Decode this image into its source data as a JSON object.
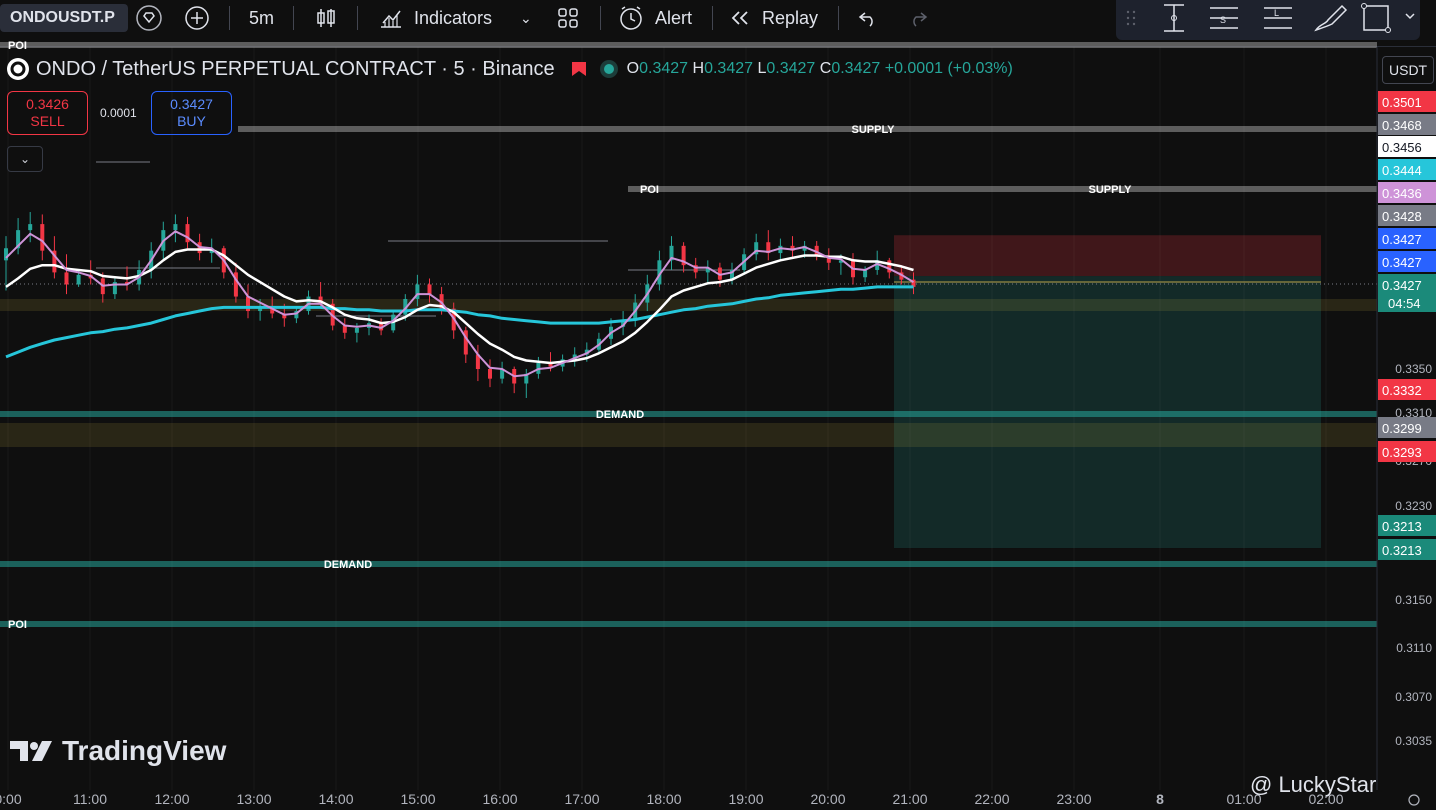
{
  "toolbar": {
    "symbol": "ONDOUSDT.P",
    "interval": "5m",
    "indicators_label": "Indicators",
    "alert_label": "Alert",
    "replay_label": "Replay",
    "icons": [
      "diamond-icon",
      "plus-circle-icon",
      "candles-icon",
      "indicators-icon",
      "chevron-down-icon",
      "layout-grid-icon",
      "alarm-clock-icon",
      "replay-rewind-icon",
      "undo-icon",
      "redo-icon"
    ]
  },
  "legend": {
    "title": "ONDO / TetherUS PERPETUAL CONTRACT · 5 · Binance",
    "o_label": "O",
    "o": "0.3427",
    "h_label": "H",
    "h": "0.3427",
    "l_label": "L",
    "l": "0.3427",
    "c_label": "C",
    "c": "0.3427",
    "change": "+0.0001 (+0.03%)"
  },
  "trade": {
    "sell_price": "0.3426",
    "sell_label": "SELL",
    "spread": "0.0001",
    "buy_price": "0.3427",
    "buy_label": "BUY"
  },
  "currency": "USDT",
  "watermark": "TradingView",
  "author": "@ LuckyStar",
  "colors": {
    "up": "#26a69a",
    "down": "#f23645",
    "ema_fast": "#ce93d8",
    "ema_mid": "#ffffff",
    "ema_slow": "#26c6da"
  },
  "chart_data": {
    "type": "candlestick",
    "ylim": [
      0.3015,
      0.352
    ],
    "x_ticks": [
      "0:00",
      "11:00",
      "12:00",
      "13:00",
      "14:00",
      "15:00",
      "16:00",
      "17:00",
      "18:00",
      "19:00",
      "20:00",
      "21:00",
      "22:00",
      "23:00",
      "8",
      "01:00",
      "02:00"
    ],
    "y_ticks": [
      "0.3350",
      "0.3310",
      "0.3270",
      "0.3230",
      "0.3150",
      "0.3110",
      "0.3070",
      "0.3035"
    ],
    "price_tags": [
      {
        "value": "0.3501",
        "price": 0.3501,
        "color": "#f23645"
      },
      {
        "value": "0.3468",
        "price": 0.3468,
        "color": "#787b86"
      },
      {
        "value": "0.3456",
        "price": 0.3456,
        "color": "#ffffff"
      },
      {
        "value": "0.3444",
        "price": 0.3444,
        "color": "#26c6da"
      },
      {
        "value": "0.3436",
        "price": 0.3436,
        "color": "#ce93d8"
      },
      {
        "value": "0.3428",
        "price": 0.3428,
        "color": "#787b86"
      },
      {
        "value": "0.3427",
        "price": 0.3427,
        "color": "#2962ff"
      },
      {
        "value": "0.3427",
        "price": 0.3417,
        "color": "#2962ff"
      },
      {
        "value": "0.3427",
        "price": 0.3406,
        "color": "#1b8a7a"
      },
      {
        "value": "0.3332",
        "price": 0.3332,
        "color": "#f23645"
      },
      {
        "value": "0.3299",
        "price": 0.3299,
        "color": "#787b86"
      },
      {
        "value": "0.3293",
        "price": 0.3293,
        "color": "#f23645"
      },
      {
        "value": "0.3213",
        "price": 0.3213,
        "color": "#1b8a7a"
      },
      {
        "value": "0.3213",
        "price": 0.32,
        "color": "#1b8a7a"
      }
    ],
    "countdown": "04:54",
    "zones": [
      {
        "label": "SUPPLY",
        "price": 0.3488
      },
      {
        "label": "SUPPLY",
        "price": 0.3439
      },
      {
        "label": "POI",
        "price": 0.3439
      },
      {
        "label": "DEMAND",
        "price": 0.3308
      },
      {
        "label": "DEMAND",
        "price": 0.3165
      },
      {
        "label": "POI",
        "price": 0.3118
      },
      {
        "label": "POI",
        "price": 0.352
      }
    ],
    "position": {
      "entry": 0.3427,
      "stop": 0.345,
      "target": 0.3215
    },
    "ohlc": [
      [
        0.344,
        0.346,
        0.3415,
        0.345
      ],
      [
        0.345,
        0.3475,
        0.3445,
        0.3465
      ],
      [
        0.3465,
        0.348,
        0.3455,
        0.347
      ],
      [
        0.347,
        0.3478,
        0.344,
        0.3448
      ],
      [
        0.3448,
        0.346,
        0.3425,
        0.343
      ],
      [
        0.343,
        0.3445,
        0.3412,
        0.342
      ],
      [
        0.342,
        0.3432,
        0.3418,
        0.3428
      ],
      [
        0.3428,
        0.344,
        0.342,
        0.3425
      ],
      [
        0.3425,
        0.343,
        0.3405,
        0.3412
      ],
      [
        0.3412,
        0.3425,
        0.3408,
        0.3422
      ],
      [
        0.3422,
        0.3435,
        0.3415,
        0.342
      ],
      [
        0.342,
        0.344,
        0.3415,
        0.3432
      ],
      [
        0.3432,
        0.3455,
        0.3425,
        0.3448
      ],
      [
        0.3448,
        0.3472,
        0.344,
        0.3465
      ],
      [
        0.3465,
        0.3478,
        0.3455,
        0.347
      ],
      [
        0.347,
        0.3476,
        0.345,
        0.3455
      ],
      [
        0.3455,
        0.3462,
        0.344,
        0.3446
      ],
      [
        0.3446,
        0.3458,
        0.3438,
        0.345
      ],
      [
        0.345,
        0.3452,
        0.3425,
        0.343
      ],
      [
        0.343,
        0.3438,
        0.3405,
        0.341
      ],
      [
        0.341,
        0.342,
        0.3392,
        0.3398
      ],
      [
        0.3398,
        0.3408,
        0.339,
        0.3402
      ],
      [
        0.3402,
        0.341,
        0.3392,
        0.3396
      ],
      [
        0.3396,
        0.3404,
        0.3385,
        0.3392
      ],
      [
        0.3392,
        0.3402,
        0.3388,
        0.3398
      ],
      [
        0.3398,
        0.3415,
        0.3395,
        0.341
      ],
      [
        0.341,
        0.3422,
        0.34,
        0.3404
      ],
      [
        0.3404,
        0.3408,
        0.3382,
        0.3386
      ],
      [
        0.3386,
        0.3392,
        0.3375,
        0.338
      ],
      [
        0.338,
        0.3388,
        0.3372,
        0.3384
      ],
      [
        0.3384,
        0.3395,
        0.3378,
        0.3388
      ],
      [
        0.3388,
        0.3392,
        0.3378,
        0.3382
      ],
      [
        0.3382,
        0.3398,
        0.338,
        0.3395
      ],
      [
        0.3395,
        0.3412,
        0.339,
        0.3408
      ],
      [
        0.3408,
        0.3428,
        0.3402,
        0.342
      ],
      [
        0.342,
        0.3425,
        0.3405,
        0.3412
      ],
      [
        0.3412,
        0.3418,
        0.3395,
        0.34
      ],
      [
        0.34,
        0.3405,
        0.3375,
        0.3382
      ],
      [
        0.3382,
        0.3385,
        0.3355,
        0.3362
      ],
      [
        0.3362,
        0.337,
        0.334,
        0.335
      ],
      [
        0.335,
        0.3358,
        0.3335,
        0.3342
      ],
      [
        0.3342,
        0.3356,
        0.3338,
        0.335
      ],
      [
        0.335,
        0.3352,
        0.333,
        0.3338
      ],
      [
        0.3338,
        0.335,
        0.3326,
        0.3346
      ],
      [
        0.3346,
        0.336,
        0.3342,
        0.3355
      ],
      [
        0.3355,
        0.3364,
        0.3348,
        0.3352
      ],
      [
        0.3352,
        0.3362,
        0.3348,
        0.3358
      ],
      [
        0.3358,
        0.3368,
        0.3352,
        0.3362
      ],
      [
        0.3362,
        0.3372,
        0.3356,
        0.3366
      ],
      [
        0.3366,
        0.338,
        0.3362,
        0.3375
      ],
      [
        0.3375,
        0.3392,
        0.337,
        0.3385
      ],
      [
        0.3385,
        0.3398,
        0.3378,
        0.339
      ],
      [
        0.339,
        0.3412,
        0.3385,
        0.3405
      ],
      [
        0.3405,
        0.3428,
        0.3398,
        0.342
      ],
      [
        0.342,
        0.3448,
        0.3415,
        0.344
      ],
      [
        0.344,
        0.346,
        0.3432,
        0.3452
      ],
      [
        0.3452,
        0.3455,
        0.343,
        0.3436
      ],
      [
        0.3436,
        0.3442,
        0.3425,
        0.343
      ],
      [
        0.343,
        0.344,
        0.342,
        0.3434
      ],
      [
        0.3434,
        0.3438,
        0.3418,
        0.3424
      ],
      [
        0.3424,
        0.3438,
        0.342,
        0.3432
      ],
      [
        0.3432,
        0.345,
        0.3428,
        0.3445
      ],
      [
        0.3445,
        0.3462,
        0.344,
        0.3455
      ],
      [
        0.3455,
        0.3465,
        0.344,
        0.3446
      ],
      [
        0.3446,
        0.3458,
        0.344,
        0.3452
      ],
      [
        0.3452,
        0.346,
        0.3442,
        0.3448
      ],
      [
        0.3448,
        0.3456,
        0.3442,
        0.3452
      ],
      [
        0.3452,
        0.3456,
        0.344,
        0.3444
      ],
      [
        0.3444,
        0.345,
        0.3432,
        0.3438
      ],
      [
        0.3438,
        0.3445,
        0.3428,
        0.344
      ],
      [
        0.344,
        0.3446,
        0.342,
        0.3426
      ],
      [
        0.3426,
        0.3435,
        0.3422,
        0.3432
      ],
      [
        0.3432,
        0.3448,
        0.3428,
        0.344
      ],
      [
        0.344,
        0.3442,
        0.3425,
        0.343
      ],
      [
        0.343,
        0.3434,
        0.342,
        0.3424
      ],
      [
        0.3424,
        0.343,
        0.3412,
        0.3418
      ]
    ],
    "ema_fast": [
      0.3442,
      0.3452,
      0.3462,
      0.3456,
      0.3444,
      0.3432,
      0.343,
      0.3427,
      0.3419,
      0.342,
      0.342,
      0.3426,
      0.344,
      0.3456,
      0.3464,
      0.3459,
      0.3451,
      0.345,
      0.344,
      0.3424,
      0.341,
      0.3405,
      0.34,
      0.3395,
      0.3396,
      0.3404,
      0.3404,
      0.3394,
      0.3386,
      0.3385,
      0.3386,
      0.3384,
      0.339,
      0.34,
      0.3412,
      0.3412,
      0.3405,
      0.3392,
      0.3376,
      0.3362,
      0.3351,
      0.335,
      0.3344,
      0.3345,
      0.335,
      0.3351,
      0.3355,
      0.3359,
      0.3363,
      0.337,
      0.338,
      0.3386,
      0.3398,
      0.3412,
      0.3428,
      0.3442,
      0.3439,
      0.3434,
      0.3434,
      0.3428,
      0.343,
      0.3439,
      0.3448,
      0.3447,
      0.345,
      0.3449,
      0.3451,
      0.3447,
      0.3442,
      0.3441,
      0.3433,
      0.3432,
      0.3437,
      0.3433,
      0.3428,
      0.3422
    ],
    "ema_mid": [
      0.3418,
      0.3425,
      0.3433,
      0.3436,
      0.3436,
      0.3433,
      0.3432,
      0.3431,
      0.3427,
      0.3426,
      0.3425,
      0.3427,
      0.3432,
      0.344,
      0.3447,
      0.3449,
      0.3449,
      0.3449,
      0.3444,
      0.3436,
      0.3428,
      0.3422,
      0.3416,
      0.341,
      0.3406,
      0.3407,
      0.3406,
      0.3401,
      0.3395,
      0.3392,
      0.3391,
      0.3388,
      0.3389,
      0.3393,
      0.3399,
      0.3403,
      0.3402,
      0.3397,
      0.3388,
      0.3379,
      0.3371,
      0.3366,
      0.336,
      0.3357,
      0.3356,
      0.3355,
      0.3356,
      0.3357,
      0.3359,
      0.3363,
      0.3368,
      0.3373,
      0.338,
      0.3389,
      0.3399,
      0.341,
      0.3415,
      0.3418,
      0.3421,
      0.3422,
      0.3424,
      0.3429,
      0.3434,
      0.3437,
      0.344,
      0.3442,
      0.3444,
      0.3444,
      0.3443,
      0.3443,
      0.344,
      0.3439,
      0.3439,
      0.3437,
      0.3435,
      0.3432
    ],
    "ema_slow": [
      0.336,
      0.3364,
      0.3368,
      0.3371,
      0.3374,
      0.3376,
      0.3378,
      0.338,
      0.3381,
      0.3383,
      0.3384,
      0.3386,
      0.3388,
      0.3391,
      0.3394,
      0.3396,
      0.3398,
      0.34,
      0.3401,
      0.3401,
      0.3401,
      0.3401,
      0.3401,
      0.3401,
      0.3401,
      0.3401,
      0.3401,
      0.34,
      0.34,
      0.3399,
      0.3399,
      0.3398,
      0.3398,
      0.3398,
      0.3399,
      0.3399,
      0.3399,
      0.3398,
      0.3397,
      0.3395,
      0.3394,
      0.3392,
      0.3391,
      0.339,
      0.3389,
      0.3388,
      0.3388,
      0.3388,
      0.3388,
      0.3388,
      0.3389,
      0.339,
      0.3391,
      0.3393,
      0.3395,
      0.3397,
      0.3399,
      0.34,
      0.3402,
      0.3403,
      0.3404,
      0.3406,
      0.3408,
      0.3409,
      0.3411,
      0.3412,
      0.3413,
      0.3414,
      0.3415,
      0.3416,
      0.3416,
      0.3417,
      0.3418,
      0.3418,
      0.3418,
      0.3418
    ]
  }
}
